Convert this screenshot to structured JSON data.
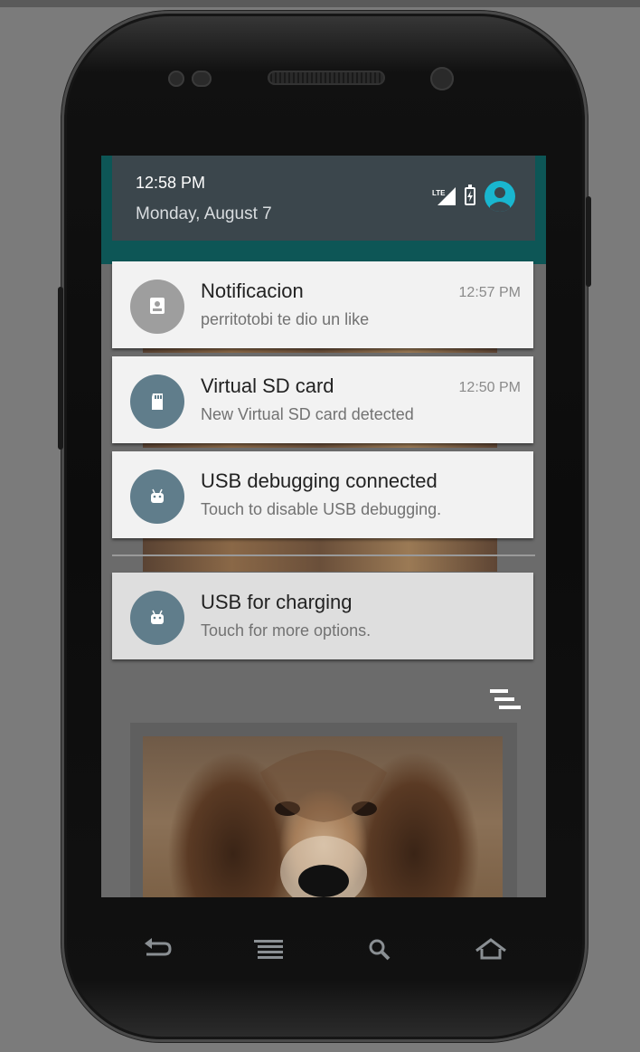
{
  "status_bar": {
    "time": "12:58 PM",
    "date": "Monday, August 7"
  },
  "notifications": [
    {
      "title": "Notificacion",
      "text": "perritotobi te dio un like",
      "time": "12:57 PM",
      "icon": "contact-card-icon",
      "icon_color": "#9e9e9e"
    },
    {
      "title": "Virtual SD card",
      "text": "New Virtual SD card detected",
      "time": "12:50 PM",
      "icon": "sd-card-icon",
      "icon_color": "#607d8b"
    },
    {
      "title": "USB debugging connected",
      "text": "Touch to disable USB debugging.",
      "icon": "android-icon",
      "icon_color": "#607d8b"
    },
    {
      "title": "USB for charging",
      "text": "Touch for more options.",
      "icon": "android-icon",
      "icon_color": "#607d8b"
    }
  ],
  "icons": {
    "signal": "signal-icon",
    "battery": "battery-charging-icon",
    "account": "account-icon",
    "clear_all": "clear-all-icon",
    "nav_back": "back-icon",
    "nav_menu": "menu-icon",
    "nav_search": "search-icon",
    "nav_home": "home-icon"
  },
  "colors": {
    "header_bg": "#3b464c",
    "accent": "#19b6cf",
    "teal_edge": "#0d5656"
  }
}
